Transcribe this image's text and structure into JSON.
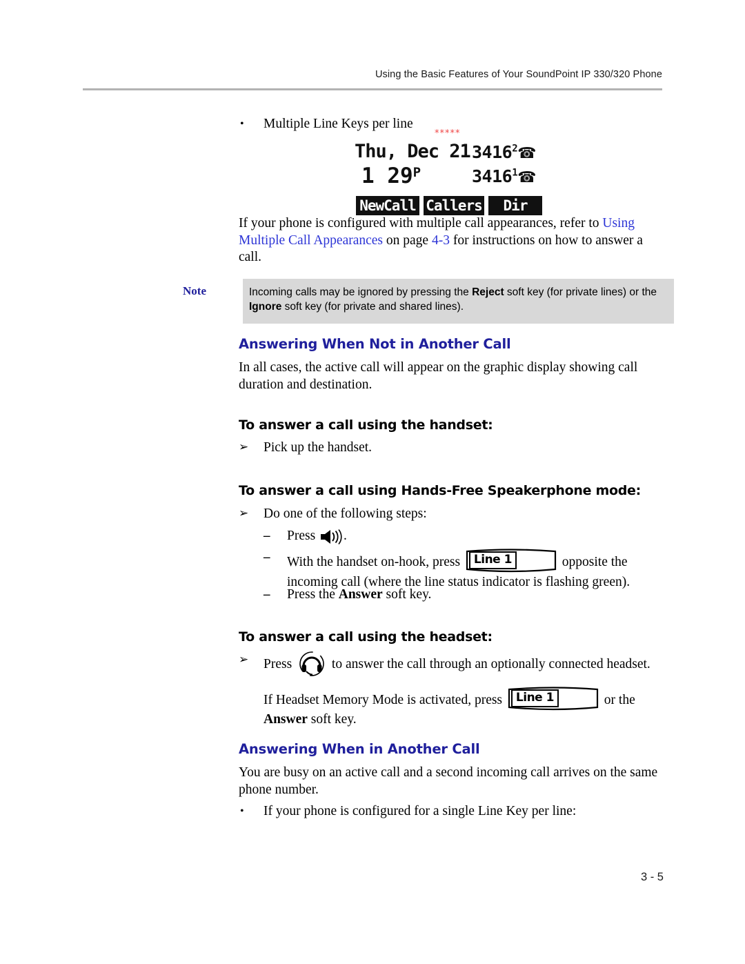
{
  "header": {
    "running_title": "Using the Basic Features of Your SoundPoint IP 330/320 Phone"
  },
  "bullets": {
    "multiple_line_keys": "Multiple Line Keys per line",
    "single_line_key": "If your phone is configured for a single Line Key per line:",
    "bullet_mark": "•"
  },
  "lcd": {
    "asterisks": "*****",
    "date": "Thu, Dec 21",
    "time": "1 29",
    "time_suffix": "P",
    "line1_number": "3416",
    "line1_super": "2",
    "line2_number": "3416",
    "line2_super": "1",
    "phone_icon": "☎",
    "softkeys": [
      "NewCall",
      "Callers",
      "Dir"
    ]
  },
  "paragraphs": {
    "multiple_call_appearances": {
      "lead": "If your phone is configured with multiple call appearances, refer to ",
      "xref_title": "Using Multiple Call Appearances",
      "mid": " on page ",
      "xref_page": "4-3",
      "tail": " for instructions on how to answer a call."
    },
    "all_cases": "In all cases, the active call will appear on the graphic display showing call duration and destination.",
    "busy_on_active_call": "You are busy on an active call and a second incoming call arrives on the same phone number."
  },
  "note": {
    "label": "Note",
    "text_part1": "Incoming calls may be ignored by pressing the ",
    "bold1": "Reject",
    "text_part2": " soft key (for private lines) or the ",
    "bold2": "Ignore",
    "text_part3": " soft key (for private and shared lines)."
  },
  "sections": {
    "answering_not_in_another_call": "Answering When Not in Another Call",
    "answering_in_another_call": "Answering When in Another Call"
  },
  "subheadings": {
    "handset": "To answer a call using the handset:",
    "speakerphone": "To answer a call using Hands-Free Speakerphone mode:",
    "headset": "To answer a call using the headset:"
  },
  "steps": {
    "arrow_mark": "➢",
    "dash_mark": "–",
    "pick_up_handset": "Pick up the handset.",
    "do_one_of_following": "Do one of the following steps:",
    "press_speaker_pre": "Press ",
    "press_speaker_post": ".",
    "on_hook_pre": "With the handset on-hook, press ",
    "on_hook_post": " opposite the incoming call (where the line status indicator is flashing green).",
    "press_answer_pre": "Press the ",
    "press_answer_bold": "Answer",
    "press_answer_post": " soft key.",
    "headset_press_pre": "Press ",
    "headset_press_post": " to answer the call through an optionally connected headset.",
    "memory_mode_pre": "If Headset Memory Mode is activated, press ",
    "memory_mode_mid": " or the ",
    "memory_mode_bold": "Answer",
    "memory_mode_post": " soft key."
  },
  "line_key": {
    "label": "Line 1"
  },
  "footer": {
    "page_number": "3 - 5"
  },
  "colors": {
    "section_heading": "#1f1f9c",
    "xref_link": "#2d35d6",
    "note_background": "#d8d8d8",
    "asterisk_red": "#ef4444"
  }
}
